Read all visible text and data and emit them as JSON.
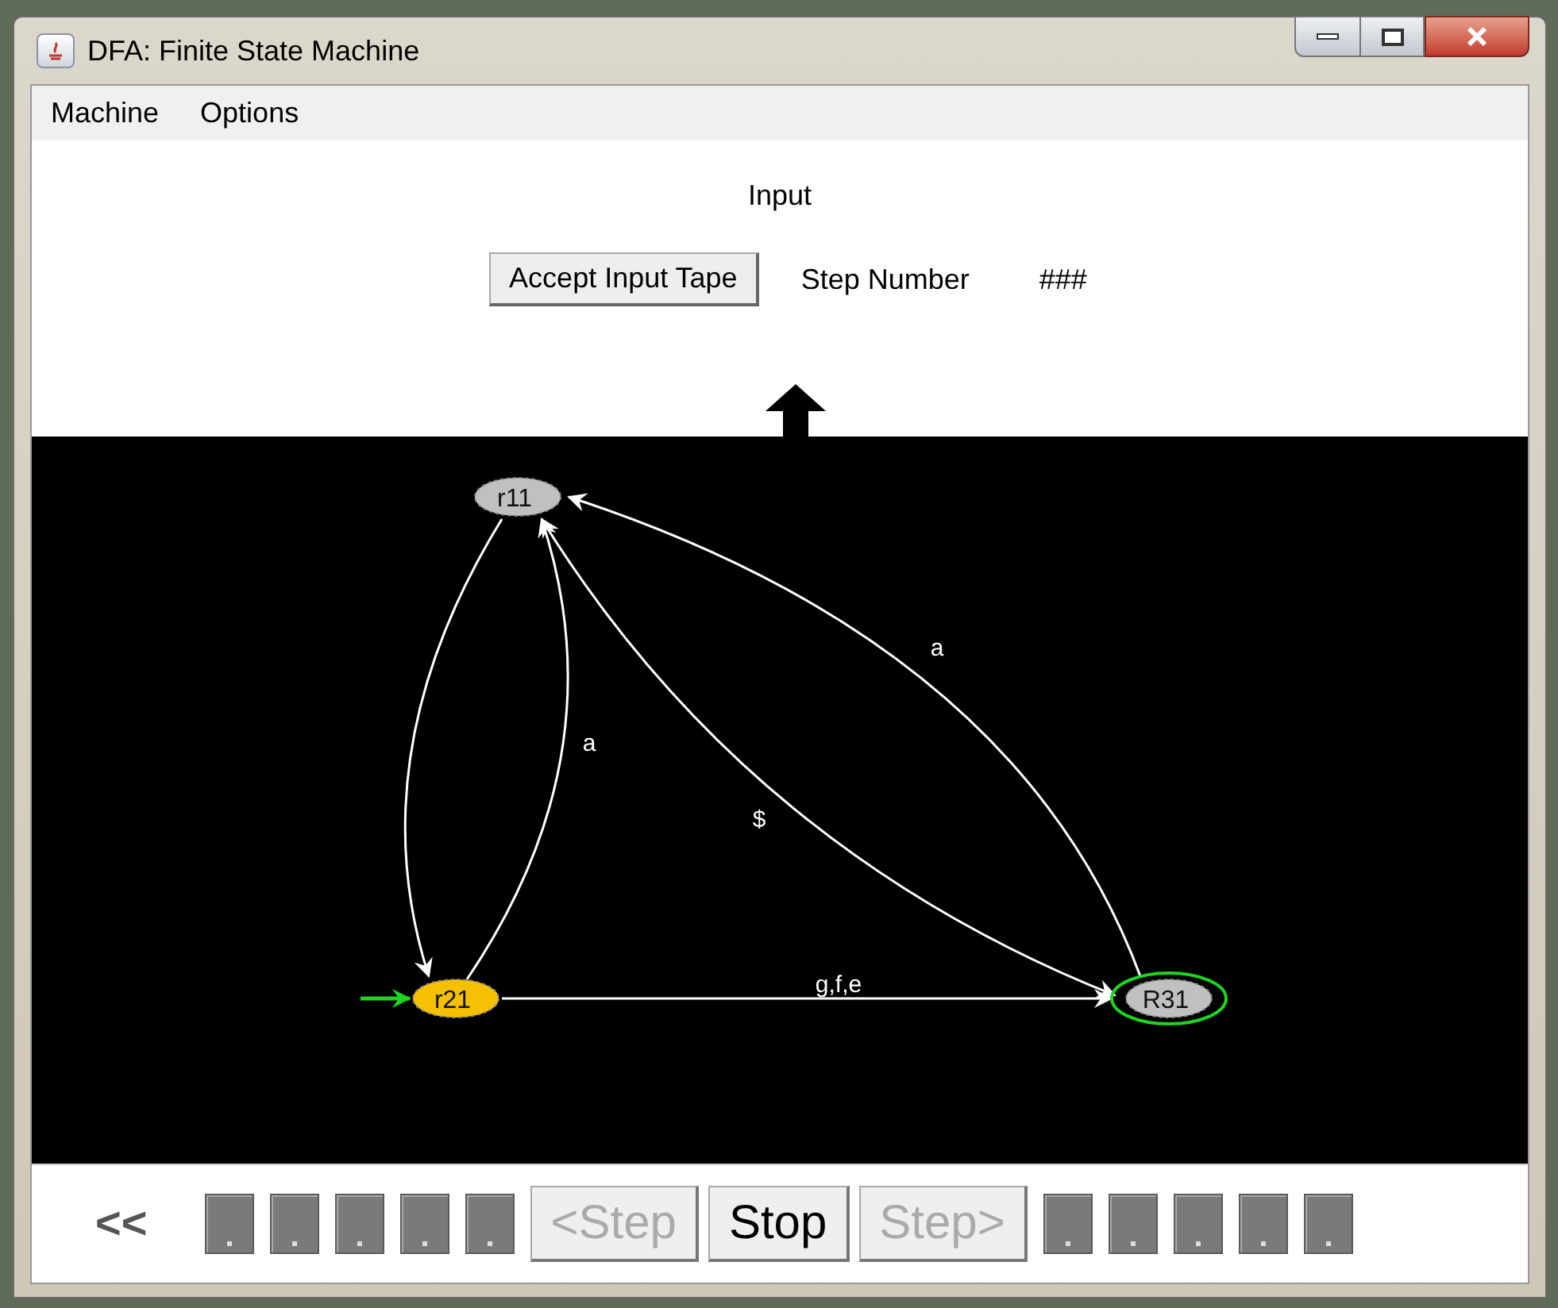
{
  "window": {
    "title": "DFA: Finite State Machine"
  },
  "menu": [
    {
      "label": "Machine"
    },
    {
      "label": "Options"
    }
  ],
  "input_label": "Input",
  "accept_button": {
    "label": "Accept Input Tape"
  },
  "step_number": {
    "label": "Step Number",
    "value": "###"
  },
  "diagram": {
    "states": [
      {
        "name": "r11",
        "current": false,
        "start": false,
        "accepting": false
      },
      {
        "name": "r21",
        "current": true,
        "start": true,
        "accepting": false
      },
      {
        "name": "R31",
        "current": false,
        "start": false,
        "accepting": true
      }
    ],
    "transitions": [
      {
        "both_ways": false
      },
      {
        "label": "a",
        "both_ways": false
      },
      {
        "label": "$",
        "both_ways": true
      },
      {
        "label": "a",
        "both_ways": false
      },
      {
        "label": "g,f,e",
        "both_ways": false
      }
    ]
  },
  "controls": {
    "rewind": "<<",
    "buttons": [
      {
        "label": "<Step",
        "disabled": true
      },
      {
        "label": "Stop",
        "disabled": false
      },
      {
        "label": "Step>",
        "disabled": true
      }
    ],
    "tape_left": [
      {
        "kind": "blank"
      },
      {
        "kind": "blank"
      },
      {
        "kind": "blank"
      },
      {
        "kind": "blank"
      },
      {
        "kind": "blank"
      }
    ],
    "tape_right": [
      {
        "kind": "blank"
      },
      {
        "kind": "blank"
      },
      {
        "kind": "blank"
      },
      {
        "kind": "blank"
      },
      {
        "kind": "blank"
      }
    ]
  }
}
